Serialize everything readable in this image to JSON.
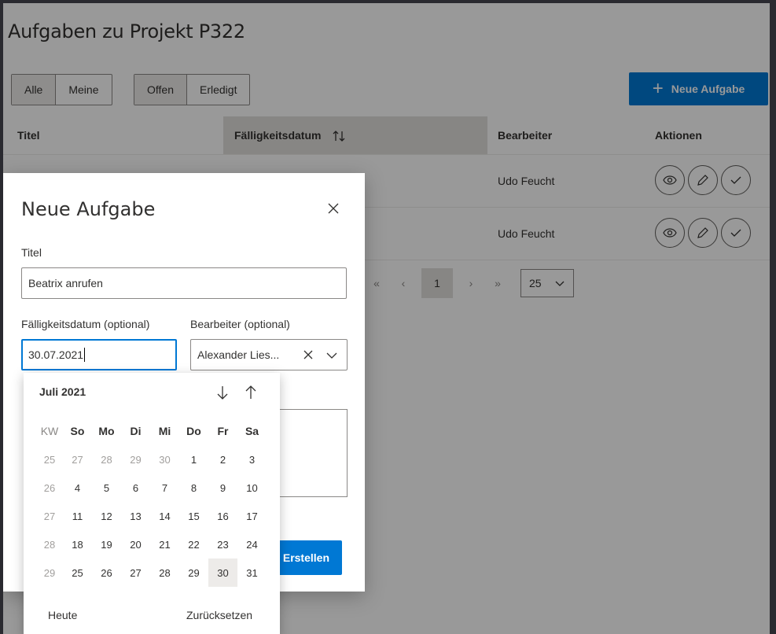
{
  "page": {
    "title": "Aufgaben zu Projekt P322"
  },
  "filters": {
    "group1": [
      {
        "label": "Alle",
        "active": true
      },
      {
        "label": "Meine",
        "active": false
      }
    ],
    "group2": [
      {
        "label": "Offen",
        "active": true
      },
      {
        "label": "Erledigt",
        "active": false
      }
    ]
  },
  "new_task_button": {
    "label": "Neue Aufgabe"
  },
  "table": {
    "columns": [
      "Titel",
      "Fälligkeitsdatum",
      "Bearbeiter",
      "Aktionen"
    ],
    "rows": [
      {
        "assignee": "Udo Feucht"
      },
      {
        "assignee": "Udo Feucht"
      }
    ]
  },
  "pagination": {
    "first": "«",
    "prev": "‹",
    "current": "1",
    "next": "›",
    "last": "»",
    "page_size": "25"
  },
  "dialog": {
    "title": "Neue Aufgabe",
    "title_label": "Titel",
    "title_value": "Beatrix anrufen",
    "due_label": "Fälligkeitsdatum (optional)",
    "due_value": "30.07.2021",
    "assignee_label": "Bearbeiter (optional)",
    "assignee_value": "Alexander Lies...",
    "create_label": "Erstellen"
  },
  "datepicker": {
    "month": "Juli",
    "year": "2021",
    "week_label": "KW",
    "weekdays": [
      "So",
      "Mo",
      "Di",
      "Mi",
      "Do",
      "Fr",
      "Sa"
    ],
    "weeks": [
      {
        "kw": "25",
        "days": [
          "27",
          "28",
          "29",
          "30",
          "1",
          "2",
          "3"
        ]
      },
      {
        "kw": "26",
        "days": [
          "4",
          "5",
          "6",
          "7",
          "8",
          "9",
          "10"
        ]
      },
      {
        "kw": "27",
        "days": [
          "11",
          "12",
          "13",
          "14",
          "15",
          "16",
          "17"
        ]
      },
      {
        "kw": "28",
        "days": [
          "18",
          "19",
          "20",
          "21",
          "22",
          "23",
          "24"
        ]
      },
      {
        "kw": "29",
        "days": [
          "25",
          "26",
          "27",
          "28",
          "29",
          "30",
          "31"
        ]
      }
    ],
    "selected_day": "30",
    "today_label": "Heute",
    "reset_label": "Zurücksetzen"
  },
  "colors": {
    "primary": "#0078d4",
    "overlay": "rgba(0,0,0,0.4)"
  },
  "icons": [
    "plus-icon",
    "sort-icon",
    "eye-icon",
    "pencil-icon",
    "check-icon",
    "close-icon",
    "chevron-down-icon",
    "arrow-down-icon",
    "arrow-up-icon"
  ]
}
